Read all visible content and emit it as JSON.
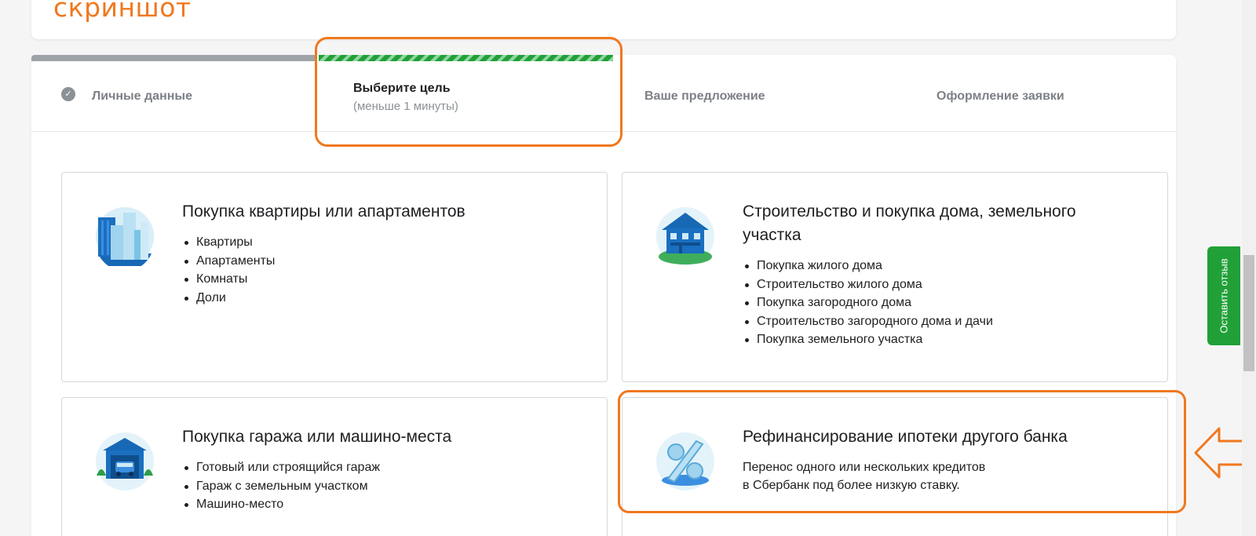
{
  "annotation": {
    "label": "скриншот"
  },
  "steps": [
    {
      "label": "Личные данные",
      "done": true
    },
    {
      "label": "Выберите цель",
      "sublabel": "(меньше 1 минуты)",
      "active": true
    },
    {
      "label": "Ваше предложение"
    },
    {
      "label": "Оформление заявки"
    }
  ],
  "goals": [
    {
      "icon": "apartment-buildings-icon",
      "title": "Покупка квартиры или апартаментов",
      "items": [
        "Квартиры",
        "Апартаменты",
        "Комнаты",
        "Доли"
      ]
    },
    {
      "icon": "house-icon",
      "title_line1": "Строительство и покупка дома, земельного",
      "title_line2": "участка",
      "items": [
        "Покупка жилого дома",
        "Строительство жилого дома",
        "Покупка загородного дома",
        "Строительство загородного дома и дачи",
        "Покупка земельного участка"
      ]
    },
    {
      "icon": "garage-icon",
      "title": "Покупка гаража или машино-места",
      "items": [
        "Готовый или строящийся гараж",
        "Гараж с земельным участком",
        "Машино-место"
      ]
    },
    {
      "icon": "percent-icon",
      "title": "Рефинансирование ипотеки другого банка",
      "desc_line1": "Перенос одного или нескольких кредитов",
      "desc_line2": "в Сбербанк под более низкую ставку."
    }
  ],
  "feedback": {
    "label": "Оставить отзыв"
  },
  "colors": {
    "accent_green": "#21a038",
    "annotation_orange": "#f0781e"
  }
}
